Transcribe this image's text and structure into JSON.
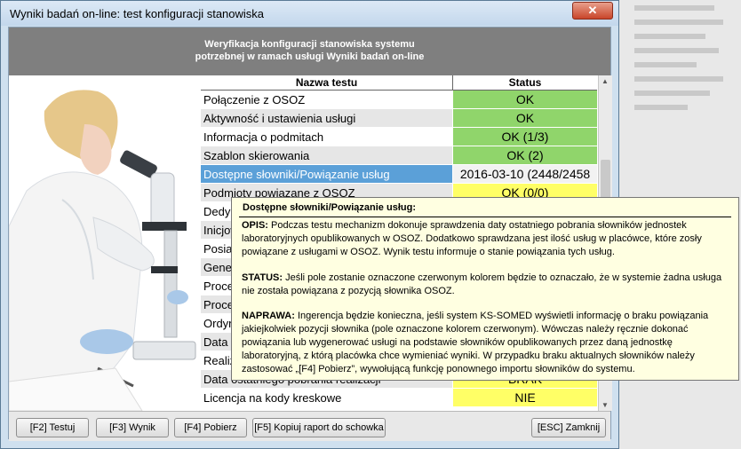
{
  "window": {
    "title": "Wyniki badań on-line: test konfiguracji stanowiska",
    "close_glyph": "✕"
  },
  "header": {
    "line1": "Weryfikacja konfiguracji stanowiska systemu",
    "line2": "potrzebnej w ramach usługi Wyniki badań on-line"
  },
  "table": {
    "col_name": "Nazwa testu",
    "col_status": "Status",
    "rows": [
      {
        "name": "Połączenie z OSOZ",
        "status": "OK"
      },
      {
        "name": "Aktywność i ustawienia usługi",
        "status": "OK"
      },
      {
        "name": "Informacja o podmitach",
        "status": "OK (1/3)"
      },
      {
        "name": "Szablon skierowania",
        "status": "OK (2)"
      },
      {
        "name": "Dostępne słowniki/Powiązanie usług",
        "status": "2016-03-10 (2448/2458"
      },
      {
        "name": "Podmioty powiązane z OSOZ",
        "status": "OK (0/0)"
      },
      {
        "name": "Dedyk",
        "status": ""
      },
      {
        "name": "Inicjow",
        "status": ""
      },
      {
        "name": "Posiad",
        "status": ""
      },
      {
        "name": "Gener",
        "status": ""
      },
      {
        "name": "Proces",
        "status": ""
      },
      {
        "name": "Proces",
        "status": ""
      },
      {
        "name": "Ordyna",
        "status": ""
      },
      {
        "name": "Data o",
        "status": ""
      },
      {
        "name": "Realiz",
        "status": ""
      },
      {
        "name": "Data ostatniego pobrania realizacji",
        "status": "BRAK"
      },
      {
        "name": "Licencja na kody kreskowe",
        "status": "NIE"
      }
    ]
  },
  "colors": {
    "ok": "#90d56b",
    "warn": "#ffff66",
    "selected": "#5ba0d8"
  },
  "buttons": {
    "test": "[F2] Testuj",
    "result": "[F3] Wynik",
    "download": "[F4] Pobierz",
    "copy": "[F5] Kopiuj raport do schowka",
    "close": "[ESC] Zamknij"
  },
  "tooltip": {
    "title": "Dostępne słowniki/Powiązanie usług:",
    "opis_label": "OPIS:",
    "opis_text": " Podczas testu mechanizm dokonuje sprawdzenia daty ostatniego pobrania słowników jednostek laboratoryjnych opublikowanych w OSOZ. Dodatkowo sprawdzana jest ilość usług w placówce, które zosły powiązane z usługami w OSOZ. Wynik testu informuje o stanie powiązania tych usług.",
    "status_label": "STATUS:",
    "status_text": " Jeśli pole zostanie oznaczone czerwonym kolorem będzie to oznaczało, że w systemie żadna usługa nie została powiązana z pozycją słownika OSOZ.",
    "naprawa_label": "NAPRAWA:",
    "naprawa_text": " Ingerencja będzie konieczna, jeśli system KS-SOMED wyświetli informację o braku powiązania jakiejkolwiek pozycji słownika (pole oznaczone kolorem czerwonym). Wówczas należy ręcznie dokonać powiązania lub wygenerować usługi na podstawie słowników opublikowanych przez daną jednostkę laboratoryjną, z którą placówka chce wymieniać wyniki. W przypadku braku aktualnych słowników należy zastosować „[F4] Pobierz”, wywołującą funkcję ponownego importu słowników do systemu."
  }
}
